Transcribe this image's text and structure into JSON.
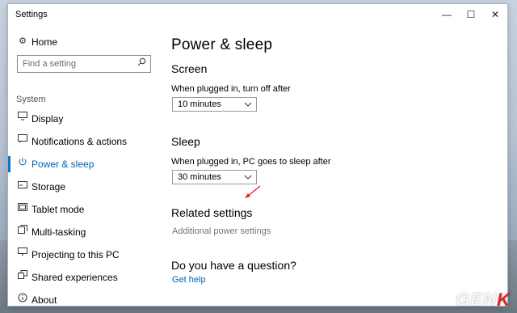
{
  "window": {
    "title": "Settings",
    "controls": {
      "minimize": "—",
      "maximize": "☐",
      "close": "✕"
    }
  },
  "sidebar": {
    "home": {
      "label": "Home",
      "icon": "gear-icon"
    },
    "search": {
      "placeholder": "Find a setting",
      "icon": "search-icon"
    },
    "section": "System",
    "items": [
      {
        "label": "Display",
        "icon": "monitor-icon",
        "active": false
      },
      {
        "label": "Notifications & actions",
        "icon": "notification-icon",
        "active": false
      },
      {
        "label": "Power & sleep",
        "icon": "power-icon",
        "active": true
      },
      {
        "label": "Storage",
        "icon": "storage-icon",
        "active": false
      },
      {
        "label": "Tablet mode",
        "icon": "tablet-icon",
        "active": false
      },
      {
        "label": "Multi-tasking",
        "icon": "multitask-icon",
        "active": false
      },
      {
        "label": "Projecting to this PC",
        "icon": "project-icon",
        "active": false
      },
      {
        "label": "Shared experiences",
        "icon": "shared-icon",
        "active": false
      },
      {
        "label": "About",
        "icon": "info-icon",
        "active": false
      }
    ]
  },
  "main": {
    "title": "Power & sleep",
    "screen": {
      "heading": "Screen",
      "label": "When plugged in, turn off after",
      "value": "10 minutes"
    },
    "sleep": {
      "heading": "Sleep",
      "label": "When plugged in, PC goes to sleep after",
      "value": "30 minutes"
    },
    "related": {
      "heading": "Related settings",
      "link": "Additional power settings"
    },
    "question": {
      "heading": "Do you have a question?",
      "link": "Get help"
    }
  },
  "annotation": {
    "color": "#e0262a"
  },
  "watermark": {
    "text_a": "GEN",
    "text_b": "K"
  },
  "colors": {
    "accent": "#0078d7",
    "link": "#0063b1"
  }
}
